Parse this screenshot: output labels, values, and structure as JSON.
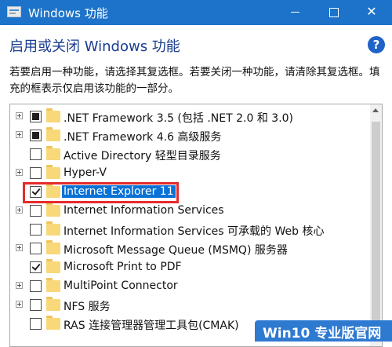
{
  "window": {
    "title": "Windows 功能",
    "minimize": "minimize",
    "maximize": "maximize",
    "close": "✕"
  },
  "header": {
    "title": "启用或关闭 Windows 功能",
    "help": "?",
    "description": "若要启用一种功能，请选择其复选框。若要关闭一种功能，请清除其复选框。填充的框表示仅启用该功能的一部分。"
  },
  "features": [
    {
      "label": ".NET Framework 3.5 (包括 .NET 2.0 和 3.0)",
      "state": "partial",
      "expandable": true
    },
    {
      "label": ".NET Framework 4.6 高级服务",
      "state": "partial",
      "expandable": true
    },
    {
      "label": "Active Directory 轻型目录服务",
      "state": "unchecked",
      "expandable": false
    },
    {
      "label": "Hyper-V",
      "state": "unchecked",
      "expandable": true
    },
    {
      "label": "Internet Explorer 11",
      "state": "checked",
      "expandable": false,
      "selected": true
    },
    {
      "label": "Internet Information Services",
      "state": "unchecked",
      "expandable": true
    },
    {
      "label": "Internet Information Services 可承载的 Web 核心",
      "state": "unchecked",
      "expandable": false
    },
    {
      "label": "Microsoft Message Queue (MSMQ) 服务器",
      "state": "unchecked",
      "expandable": true
    },
    {
      "label": "Microsoft Print to PDF",
      "state": "checked",
      "expandable": false
    },
    {
      "label": "MultiPoint Connector",
      "state": "unchecked",
      "expandable": true
    },
    {
      "label": "NFS 服务",
      "state": "unchecked",
      "expandable": true
    },
    {
      "label": "RAS 连接管理器管理工具包(CMAK)",
      "state": "unchecked",
      "expandable": false
    }
  ],
  "watermark": {
    "text": "Win10 专业版官网"
  },
  "colors": {
    "titlebar": "#1d73c9",
    "selection": "#0a72d6",
    "highlight_box": "#e52b2b",
    "heading": "#1a3d8f"
  }
}
